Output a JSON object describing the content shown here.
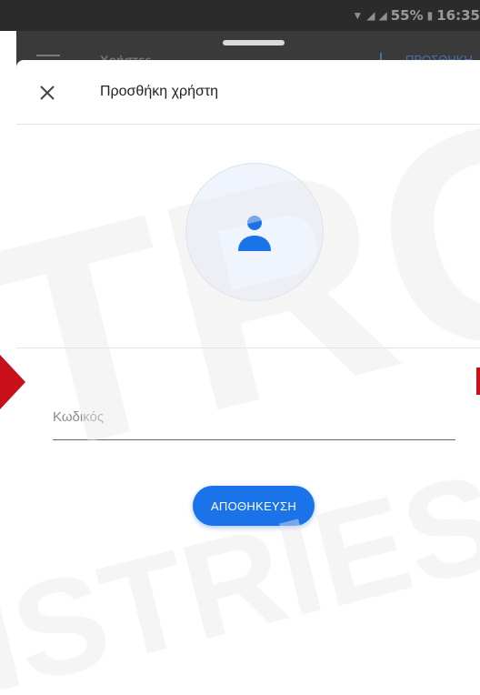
{
  "status_bar": {
    "battery_percent": "55%",
    "time": "16:35"
  },
  "background_app": {
    "title": "Χρήστες",
    "action_label": "ΠΡΟΣΘΗΚΗ"
  },
  "sheet": {
    "title": "Προσθήκη χρήστη",
    "password_label": "Κωδικός",
    "save_label": "ΑΠΟΘΗΚΕΥΣΗ"
  },
  "watermark": {
    "line1": "TRO",
    "line2": "ISTRIES"
  },
  "colors": {
    "accent": "#1a73e8",
    "watermark": "#f3f3f3",
    "watermark_arrow": "#c8101a"
  }
}
